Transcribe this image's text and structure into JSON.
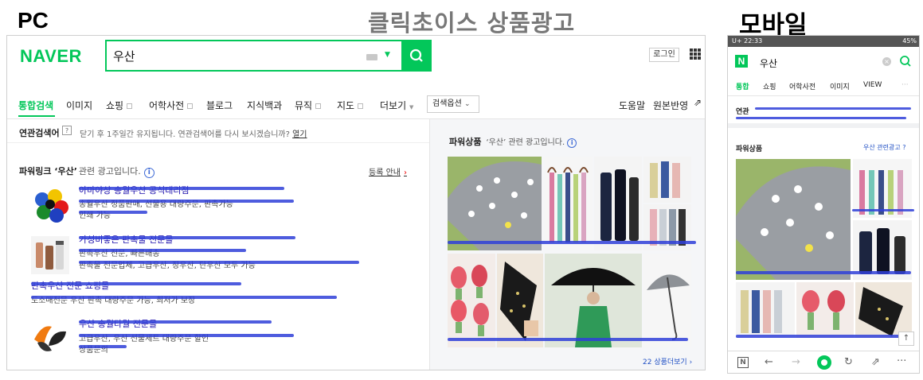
{
  "labels": {
    "pc": "PC",
    "title": "클릭초이스 상품광고",
    "mobile": "모바일"
  },
  "pc": {
    "logo": "NAVER",
    "query": "우산",
    "login": "로그인",
    "nav": {
      "tabs": [
        "통합검색",
        "이미지",
        "쇼핑",
        "어학사전",
        "블로그",
        "지식백과",
        "뮤직",
        "지도",
        "더보기"
      ],
      "options": "검색옵션",
      "help": "도움말",
      "original": "원본반영"
    },
    "related": {
      "title": "연관검색어",
      "help": "?",
      "message": "닫기 후 1주일간 유지됩니다. 연관검색어를 다시 보시겠습니까?",
      "link": "열기"
    },
    "powerlink": {
      "title": "파워링크 ‘우산’",
      "subtitle": "관련 광고입니다.",
      "register": "등록 안내",
      "ads": [
        {
          "title": "아마야상 송월우산 공식대리점",
          "lines": [
            "송월우산 정품판매, 선물용 대량주문, 판촉가능",
            "인쇄 가능"
          ]
        },
        {
          "title": "가성비좋은 판촉물 전문몰",
          "lines": [
            "판촉우산 전문, 빠른배송",
            "판촉물 전문업체, 고급우산, 장우산, 단우산 모두 가능"
          ]
        },
        {
          "title": "판촉우산 전문 쇼핑몰",
          "lines": [
            "도소매전문 우산 판촉 대량주문 가능, 최저가 보장"
          ]
        },
        {
          "title": "우산 송월타월 전문몰",
          "lines": [
            "고급우산, 우산 선물세트 대량주문 할인",
            "상품문의"
          ]
        }
      ]
    },
    "powershop": {
      "title": "파워상품",
      "subtitle": "‘우산’ 관련 광고입니다.",
      "more": "22 상품더보기 ›"
    }
  },
  "mobile": {
    "status_left": "U+ 22:33",
    "status_right": "45%",
    "logo": "N",
    "query": "우산",
    "tabs": [
      "통합",
      "쇼핑",
      "어학사전",
      "이미지",
      "VIEW",
      "···"
    ],
    "related_title": "연관",
    "powershop_title": "파워상품",
    "powershop_related": "우산 관련광고 ?",
    "top_button": "↑"
  },
  "colors": {
    "naver_green": "#03c75a",
    "redact_blue": "#2f3fd8"
  }
}
